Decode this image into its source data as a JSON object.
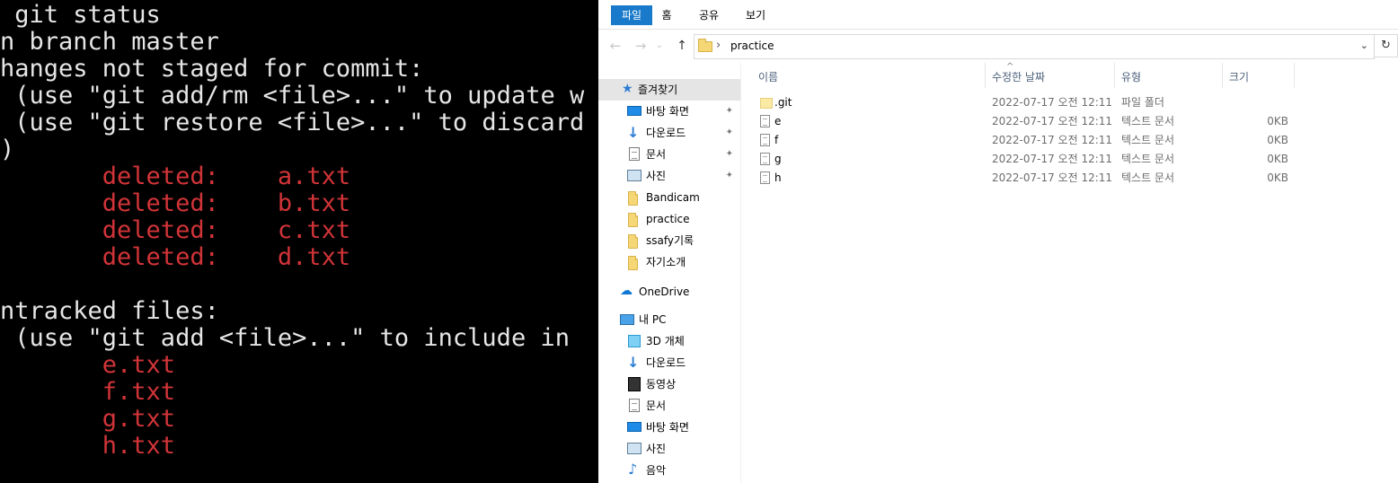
{
  "terminal": {
    "lines": [
      {
        "text": " git status",
        "color": "white"
      },
      {
        "text": "n branch master",
        "color": "white"
      },
      {
        "text": "hanges not staged for commit:",
        "color": "white"
      },
      {
        "text": " (use \"git add/rm <file>...\" to update w",
        "color": "white"
      },
      {
        "text": " (use \"git restore <file>...\" to discard",
        "color": "white"
      },
      {
        "text": ")",
        "color": "white"
      },
      {
        "text": "       deleted:    a.txt",
        "color": "red"
      },
      {
        "text": "       deleted:    b.txt",
        "color": "red"
      },
      {
        "text": "       deleted:    c.txt",
        "color": "red"
      },
      {
        "text": "       deleted:    d.txt",
        "color": "red"
      },
      {
        "text": "",
        "color": "white"
      },
      {
        "text": "ntracked files:",
        "color": "white"
      },
      {
        "text": " (use \"git add <file>...\" to include in",
        "color": "white"
      },
      {
        "text": "       e.txt",
        "color": "red"
      },
      {
        "text": "       f.txt",
        "color": "red"
      },
      {
        "text": "       g.txt",
        "color": "red"
      },
      {
        "text": "       h.txt",
        "color": "red"
      }
    ],
    "colors": {
      "white": "#e6e6e6",
      "red": "#d13438",
      "background": "#000000"
    }
  },
  "explorer": {
    "ribbon_tabs": [
      "파일",
      "홈",
      "공유",
      "보기"
    ],
    "active_tab": "파일",
    "accent_color": "#1979ca",
    "address": {
      "path": "practice",
      "separator": "›",
      "dropdown": "⌄",
      "refresh": "↻"
    },
    "nav_buttons": {
      "back": "←",
      "forward": "→",
      "recent": "⌄",
      "up": "↑"
    },
    "nav_pane": {
      "quick_access_label": "즐겨찾기",
      "quick_access": [
        {
          "label": "바탕 화면",
          "icon": "desktop-icon",
          "pinned": true
        },
        {
          "label": "다운로드",
          "icon": "download-icon",
          "pinned": true
        },
        {
          "label": "문서",
          "icon": "document-icon",
          "pinned": true
        },
        {
          "label": "사진",
          "icon": "pictures-icon",
          "pinned": true
        },
        {
          "label": "Bandicam",
          "icon": "folder-icon",
          "pinned": false
        },
        {
          "label": "practice",
          "icon": "folder-icon",
          "pinned": false
        },
        {
          "label": "ssafy기록",
          "icon": "folder-icon",
          "pinned": false
        },
        {
          "label": "자기소개",
          "icon": "folder-icon",
          "pinned": false
        }
      ],
      "onedrive_label": "OneDrive",
      "pc_label": "내 PC",
      "pc_items": [
        {
          "label": "3D 개체",
          "icon": "3d-objects-icon"
        },
        {
          "label": "다운로드",
          "icon": "download-icon"
        },
        {
          "label": "동영상",
          "icon": "videos-icon"
        },
        {
          "label": "문서",
          "icon": "document-icon"
        },
        {
          "label": "바탕 화면",
          "icon": "desktop-icon"
        },
        {
          "label": "사진",
          "icon": "pictures-icon"
        },
        {
          "label": "음악",
          "icon": "music-icon"
        }
      ],
      "pin_glyph": "📌"
    },
    "columns": {
      "name": "이름",
      "modified": "수정한 날짜",
      "type": "유형",
      "size": "크기",
      "sort_indicator": "^"
    },
    "files": [
      {
        "name": ".git",
        "modified": "2022-07-17 오전 12:11",
        "type": "파일 폴더",
        "size": "",
        "kind": "folder"
      },
      {
        "name": "e",
        "modified": "2022-07-17 오전 12:11",
        "type": "텍스트 문서",
        "size": "0KB",
        "kind": "text"
      },
      {
        "name": "f",
        "modified": "2022-07-17 오전 12:11",
        "type": "텍스트 문서",
        "size": "0KB",
        "kind": "text"
      },
      {
        "name": "g",
        "modified": "2022-07-17 오전 12:11",
        "type": "텍스트 문서",
        "size": "0KB",
        "kind": "text"
      },
      {
        "name": "h",
        "modified": "2022-07-17 오전 12:11",
        "type": "텍스트 문서",
        "size": "0KB",
        "kind": "text"
      }
    ]
  }
}
